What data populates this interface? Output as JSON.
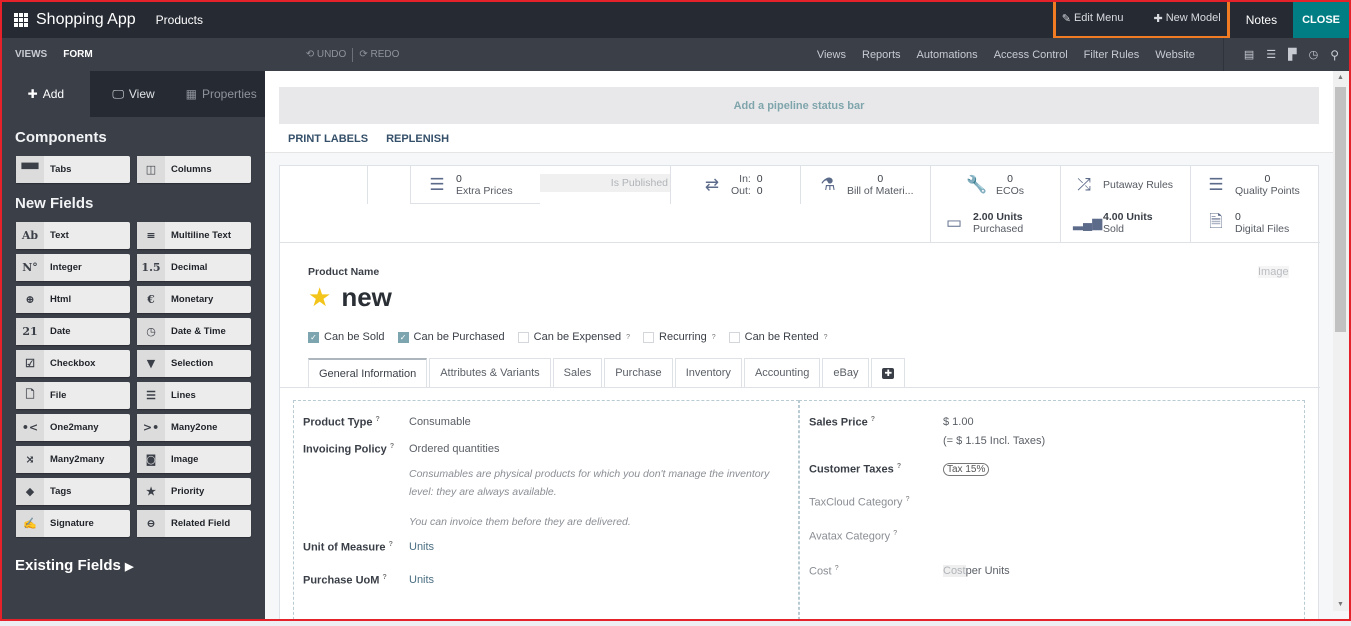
{
  "topbar": {
    "app_name": "Shopping App",
    "breadcrumb": "Products",
    "edit_menu": "Edit Menu",
    "new_model": "New Model",
    "notes": "Notes",
    "close": "CLOSE"
  },
  "subbar": {
    "views": "VIEWS",
    "form": "FORM",
    "undo": "UNDO",
    "redo": "REDO",
    "menus": [
      "Views",
      "Reports",
      "Automations",
      "Access Control",
      "Filter Rules",
      "Website"
    ],
    "view_icons": [
      "kanban-card-icon",
      "list-icon",
      "dashboard-icon",
      "clock-icon",
      "search-icon"
    ]
  },
  "sidebar": {
    "tabs": [
      {
        "label": "Add",
        "icon": "plus-icon"
      },
      {
        "label": "View",
        "icon": "monitor-icon"
      },
      {
        "label": "Properties",
        "icon": "properties-icon"
      }
    ],
    "components_title": "Components",
    "components": [
      {
        "label": "Tabs",
        "icon": "tabs-icon",
        "glyph": "▀▀"
      },
      {
        "label": "Columns",
        "icon": "columns-icon",
        "glyph": "◫"
      }
    ],
    "new_fields_title": "New Fields",
    "new_fields": [
      {
        "label": "Text",
        "icon": "text-icon",
        "glyph": "Ab"
      },
      {
        "label": "Multiline Text",
        "icon": "multiline-icon",
        "glyph": "≡"
      },
      {
        "label": "Integer",
        "icon": "integer-icon",
        "glyph": "N°"
      },
      {
        "label": "Decimal",
        "icon": "decimal-icon",
        "glyph": "1.5"
      },
      {
        "label": "Html",
        "icon": "globe-icon",
        "glyph": "⊕"
      },
      {
        "label": "Monetary",
        "icon": "euro-icon",
        "glyph": "€"
      },
      {
        "label": "Date",
        "icon": "calendar-icon",
        "glyph": "21"
      },
      {
        "label": "Date & Time",
        "icon": "calendar-clock-icon",
        "glyph": "◷"
      },
      {
        "label": "Checkbox",
        "icon": "checkbox-icon",
        "glyph": "☑"
      },
      {
        "label": "Selection",
        "icon": "caret-down-icon",
        "glyph": "▼"
      },
      {
        "label": "File",
        "icon": "file-icon",
        "glyph": "🗋"
      },
      {
        "label": "Lines",
        "icon": "lines-icon",
        "glyph": "☰"
      },
      {
        "label": "One2many",
        "icon": "one2many-icon",
        "glyph": "•<"
      },
      {
        "label": "Many2one",
        "icon": "many2one-icon",
        "glyph": ">•"
      },
      {
        "label": "Many2many",
        "icon": "many2many-icon",
        "glyph": "⤨"
      },
      {
        "label": "Image",
        "icon": "camera-icon",
        "glyph": "◙"
      },
      {
        "label": "Tags",
        "icon": "tag-icon",
        "glyph": "◆"
      },
      {
        "label": "Priority",
        "icon": "star-icon",
        "glyph": "★"
      },
      {
        "label": "Signature",
        "icon": "signature-icon",
        "glyph": "✍"
      },
      {
        "label": "Related Field",
        "icon": "link-icon",
        "glyph": "⊖"
      }
    ],
    "existing_fields": "Existing Fields"
  },
  "main": {
    "pipeline": "Add a pipeline status bar",
    "actions": [
      "PRINT LABELS",
      "REPLENISH"
    ],
    "stats": {
      "extra_prices_num": "0",
      "extra_prices": "Extra Prices",
      "is_published": "Is Published",
      "in_label": "In:",
      "in_val": "0",
      "out_label": "Out:",
      "out_val": "0",
      "bom_num": "0",
      "bom": "Bill of Materi...",
      "ecos_num": "0",
      "ecos": "ECOs",
      "purchased_num": "2.00 Units",
      "purchased": "Purchased",
      "putaway": "Putaway Rules",
      "sold_num": "4.00 Units",
      "sold": "Sold",
      "quality_num": "0",
      "quality": "Quality Points",
      "digital_num": "0",
      "digital": "Digital Files"
    },
    "product_name_label": "Product Name",
    "product_name": "new",
    "image_placeholder": "Image",
    "checkboxes": [
      {
        "label": "Can be Sold",
        "checked": true,
        "help": false
      },
      {
        "label": "Can be Purchased",
        "checked": true,
        "help": false
      },
      {
        "label": "Can be Expensed",
        "checked": false,
        "help": true
      },
      {
        "label": "Recurring",
        "checked": false,
        "help": true
      },
      {
        "label": "Can be Rented",
        "checked": false,
        "help": true
      }
    ],
    "tabs": [
      "General Information",
      "Attributes & Variants",
      "Sales",
      "Purchase",
      "Inventory",
      "Accounting",
      "eBay"
    ],
    "left_fields": {
      "product_type_label": "Product Type",
      "product_type": "Consumable",
      "invoicing_label": "Invoicing Policy",
      "invoicing": "Ordered quantities",
      "note1": "Consumables are physical products for which you don't manage the inventory level: they are always available.",
      "note2": "You can invoice them before they are delivered.",
      "uom_label": "Unit of Measure",
      "uom": "Units",
      "puom_label": "Purchase UoM",
      "puom": "Units"
    },
    "right_fields": {
      "sales_price_label": "Sales Price",
      "sales_price": "$ 1.00",
      "incl_taxes": "(= $ 1.15 Incl. Taxes)",
      "customer_taxes_label": "Customer Taxes",
      "customer_taxes": "Tax 15%",
      "taxcloud_label": "TaxCloud Category",
      "avatax_label": "Avatax Category",
      "cost_label": "Cost",
      "cost_placeholder": "Cost",
      "cost_suffix": "per Units"
    },
    "help_mark": "?"
  }
}
